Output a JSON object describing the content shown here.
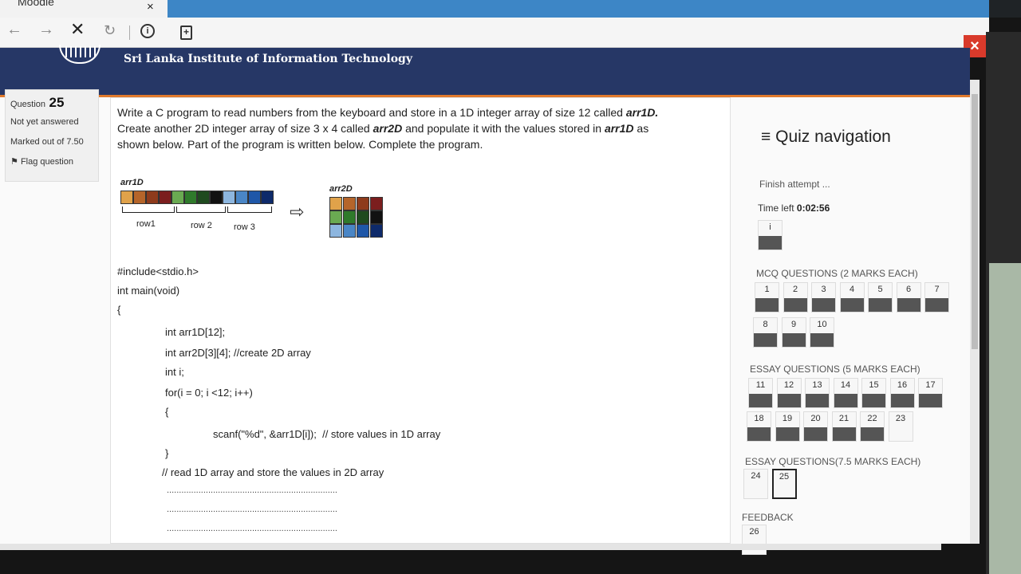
{
  "browser": {
    "tab_title": "Moodle",
    "tab_close": "×",
    "back": "←",
    "forward": "→",
    "stop": "✕",
    "reload": "↻",
    "info": "i",
    "page": "+"
  },
  "site": {
    "name": "Sri Lanka Institute of Information Technology",
    "close": "×"
  },
  "question_info": {
    "label": "Question",
    "number": "25",
    "state": "Not yet answered",
    "marks": "Marked out of 7.50",
    "flag": "Flag question"
  },
  "question": {
    "line1": "Write a C program to read numbers from the keyboard and store in  a 1D integer array of size 12 called ",
    "arr1": "arr1D.",
    "line2a": "Create another 2D integer array of size 3 x 4 called ",
    "arr2": "arr2D",
    "line2b": " and populate it with the values stored in ",
    "arr1b": "arr1D",
    "line2c": " as",
    "line3": "shown below. Part of the program is written below. Complete the program.",
    "diagram": {
      "arr1_label": "arr1D",
      "arr2_label": "arr2D",
      "row1": "row1",
      "row2": "row 2",
      "row3": "row 3",
      "colors_1d": [
        "#e0a24a",
        "#b5652a",
        "#8e3b1c",
        "#7b1e1e",
        "#6aaa52",
        "#2f7a2b",
        "#1f4a1f",
        "#111111",
        "#8db6df",
        "#4a86c6",
        "#1f57a8",
        "#0e2a6a"
      ]
    },
    "code": [
      "#include<stdio.h>",
      "int main(void)",
      "{",
      "int arr1D[12];",
      "int arr2D[3][4]; //create 2D array",
      "int i;",
      "for(i = 0; i <12; i++)",
      "{",
      "scanf(\"%d\", &arr1D[i]);  // store values in 1D array",
      "}",
      "// read 1D array and store the values in 2D array"
    ],
    "dots": "......................................................................"
  },
  "nav": {
    "title": "Quiz navigation",
    "finish": "Finish attempt ...",
    "time_label": "Time left ",
    "time_value": "0:02:56",
    "info_btn": "i",
    "mcq_label": "MCQ QUESTIONS (2 MARKS EACH)",
    "essay5_label": "ESSAY QUESTIONS (5 MARKS EACH)",
    "essay75_label": "ESSAY QUESTIONS(7.5 MARKS EACH)",
    "feedback_label": "FEEDBACK",
    "mcq": [
      "1",
      "2",
      "3",
      "4",
      "5",
      "6",
      "7",
      "8",
      "9",
      "10"
    ],
    "essay5": [
      "11",
      "12",
      "13",
      "14",
      "15",
      "16",
      "17",
      "18",
      "19",
      "20",
      "21",
      "22",
      "23"
    ],
    "essay75": [
      "24",
      "25"
    ],
    "feedback": [
      "26"
    ]
  }
}
